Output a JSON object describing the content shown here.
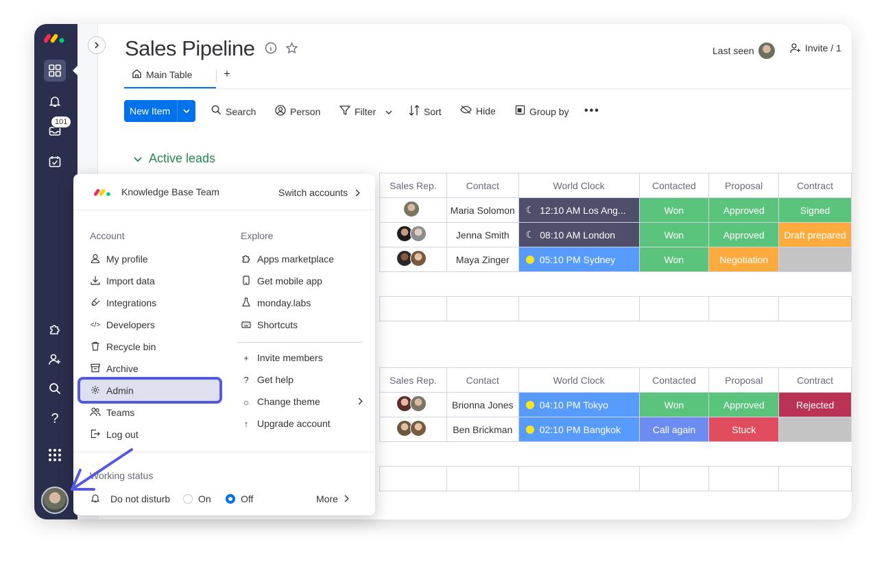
{
  "header": {
    "title": "Sales Pipeline",
    "last_seen_label": "Last seen",
    "invite_label": "Invite / 1"
  },
  "tabs": {
    "main_label": "Main Table",
    "add_label": "+"
  },
  "toolbar": {
    "new_item": "New Item",
    "search": "Search",
    "person": "Person",
    "filter": "Filter",
    "sort": "Sort",
    "hide": "Hide",
    "group_by": "Group by",
    "more": "•••"
  },
  "rail": {
    "inbox_badge": "101"
  },
  "group": {
    "title": "Active leads"
  },
  "table": {
    "columns": [
      "Sales Rep.",
      "Contact",
      "World Clock",
      "Contacted",
      "Proposal",
      "Contract"
    ],
    "rows_a": [
      {
        "contact": "Maria Solomon",
        "clock": "12:10 AM Los Ang...",
        "contacted": "Won",
        "proposal": "Approved",
        "contract": "Signed"
      },
      {
        "contact": "Jenna Smith",
        "clock": "08:10 AM London",
        "contacted": "Won",
        "proposal": "Approved",
        "contract": "Draft prepared"
      },
      {
        "contact": "Maya Zinger",
        "clock": "05:10 PM Sydney",
        "contacted": "Won",
        "proposal": "Negotiation",
        "contract": ""
      }
    ],
    "rows_b": [
      {
        "contact": "Brionna Jones",
        "clock": "04:10 PM Tokyo",
        "contacted": "Won",
        "proposal": "Approved",
        "contract": "Rejected"
      },
      {
        "contact": "Ben Brickman",
        "clock": "02:10 PM Bangkok",
        "contacted": "Call again",
        "proposal": "Stuck",
        "contract": ""
      }
    ]
  },
  "menu": {
    "team_name": "Knowledge Base Team",
    "switch_accounts": "Switch accounts",
    "account_heading": "Account",
    "explore_heading": "Explore",
    "account_items": [
      "My profile",
      "Import data",
      "Integrations",
      "Developers",
      "Recycle bin",
      "Archive",
      "Admin",
      "Teams",
      "Log out"
    ],
    "explore_items": [
      "Apps marketplace",
      "Get mobile app",
      "monday.labs",
      "Shortcuts"
    ],
    "explore_items_2": [
      "Invite members",
      "Get help",
      "Change theme",
      "Upgrade account"
    ],
    "working_status": "Working status",
    "do_not_disturb": "Do not disturb",
    "on": "On",
    "off": "Off",
    "more": "More"
  },
  "colors": {
    "green": "#00c875",
    "won": "#5ac47d",
    "orange": "#fdab3d",
    "blue_clock": "#579bfc",
    "dark_clock": "#4f4e6b",
    "red": "#bb3354",
    "stuck": "#df4d5f",
    "call_again": "#6c8cf1",
    "grey": "#c4c4c4",
    "accent": "#0073ea",
    "highlight": "#5559df"
  }
}
